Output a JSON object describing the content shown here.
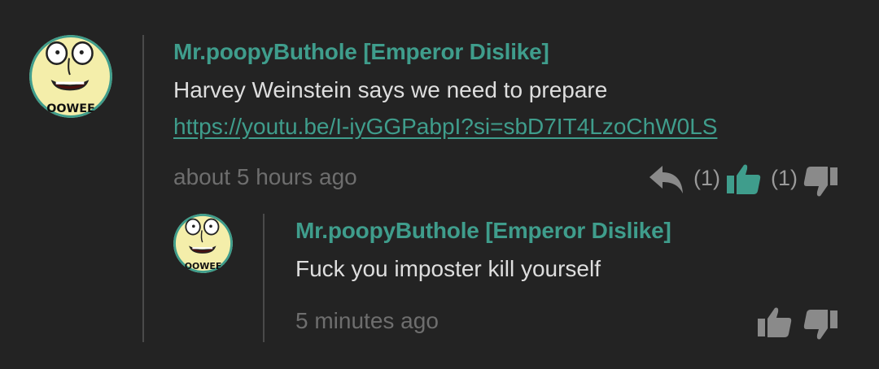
{
  "comments": [
    {
      "author": "Mr.poopyButhole [Emperor Dislike]",
      "avatar_text": "OOWEE",
      "text": "Harvey Weinstein says we need to prepare",
      "link": "https://youtu.be/I-iyGGPabpI?si=sbD7IT4LzoChW0LS",
      "time": "about 5 hours ago",
      "like_count": "(1)",
      "dislike_count": "(1)"
    },
    {
      "author": "Mr.poopyButhole [Emperor Dislike]",
      "avatar_text": "OOWEE",
      "text": "Fuck you imposter kill yourself",
      "time": "5 minutes ago"
    }
  ],
  "colors": {
    "background": "#232323",
    "accent": "#3f9d8c",
    "text": "#dedede",
    "muted": "#6e6e6e",
    "icon": "#8a8a8a"
  },
  "icons": {
    "reply": "reply-arrow-icon",
    "like": "thumbs-up-icon",
    "dislike": "thumbs-down-icon"
  }
}
